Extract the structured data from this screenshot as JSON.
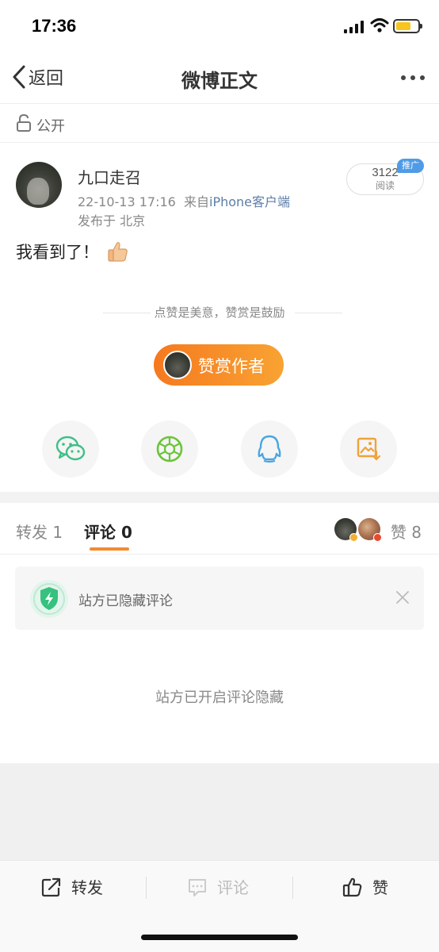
{
  "status_bar": {
    "time": "17:36"
  },
  "nav": {
    "back_label": "返回",
    "title": "微博正文"
  },
  "privacy": {
    "label": "公开"
  },
  "post": {
    "user_name": "九口走召",
    "date": "22-10-13 17:16",
    "source_prefix": "来自",
    "source": "iPhone客户端",
    "location": "发布于 北京",
    "text": "我看到了！",
    "reads_count": "3122",
    "reads_label": "阅读",
    "promo_badge": "推广"
  },
  "reward": {
    "tip": "点赞是美意，赞赏是鼓励",
    "button_label": "赞赏作者"
  },
  "tabs": {
    "repost": "转发 1",
    "comment": "评论 0",
    "like": "赞 8"
  },
  "comments": {
    "notice": "站方已隐藏评论",
    "hidden_message": "站方已开启评论隐藏"
  },
  "toolbar": {
    "repost": "转发",
    "comment": "评论",
    "like": "赞"
  },
  "colors": {
    "accent_orange": "#f6791f",
    "link_blue": "#5d7ea8",
    "wechat_green": "#3fbf87",
    "moments_green": "#6cc43a",
    "qq_blue": "#4aa6e0",
    "save_orange": "#f0a23a"
  },
  "icons": [
    "back-chevron-icon",
    "more-icon",
    "lock-icon",
    "thumbs-up-emoji",
    "wechat-icon",
    "moments-icon",
    "qq-icon",
    "save-image-icon",
    "shield-icon",
    "close-icon",
    "repost-icon",
    "comment-icon",
    "like-icon"
  ]
}
